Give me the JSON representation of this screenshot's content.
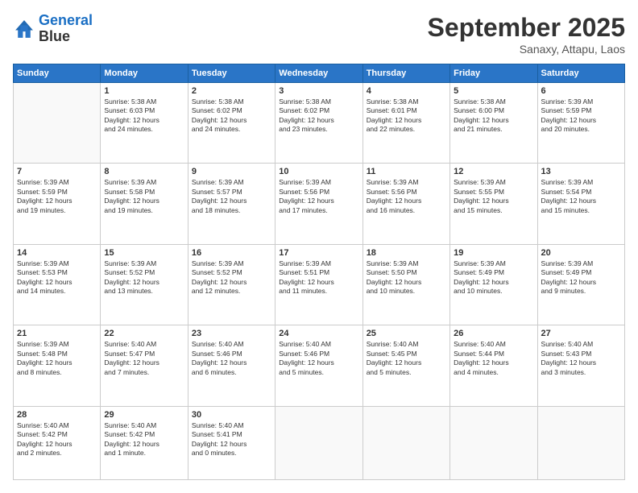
{
  "header": {
    "logo": {
      "line1": "General",
      "line2": "Blue"
    },
    "title": "September 2025",
    "subtitle": "Sanaxy, Attapu, Laos"
  },
  "weekdays": [
    "Sunday",
    "Monday",
    "Tuesday",
    "Wednesday",
    "Thursday",
    "Friday",
    "Saturday"
  ],
  "weeks": [
    [
      {
        "day": null,
        "lines": []
      },
      {
        "day": "1",
        "lines": [
          "Sunrise: 5:38 AM",
          "Sunset: 6:03 PM",
          "Daylight: 12 hours",
          "and 24 minutes."
        ]
      },
      {
        "day": "2",
        "lines": [
          "Sunrise: 5:38 AM",
          "Sunset: 6:02 PM",
          "Daylight: 12 hours",
          "and 24 minutes."
        ]
      },
      {
        "day": "3",
        "lines": [
          "Sunrise: 5:38 AM",
          "Sunset: 6:02 PM",
          "Daylight: 12 hours",
          "and 23 minutes."
        ]
      },
      {
        "day": "4",
        "lines": [
          "Sunrise: 5:38 AM",
          "Sunset: 6:01 PM",
          "Daylight: 12 hours",
          "and 22 minutes."
        ]
      },
      {
        "day": "5",
        "lines": [
          "Sunrise: 5:38 AM",
          "Sunset: 6:00 PM",
          "Daylight: 12 hours",
          "and 21 minutes."
        ]
      },
      {
        "day": "6",
        "lines": [
          "Sunrise: 5:39 AM",
          "Sunset: 5:59 PM",
          "Daylight: 12 hours",
          "and 20 minutes."
        ]
      }
    ],
    [
      {
        "day": "7",
        "lines": [
          "Sunrise: 5:39 AM",
          "Sunset: 5:59 PM",
          "Daylight: 12 hours",
          "and 19 minutes."
        ]
      },
      {
        "day": "8",
        "lines": [
          "Sunrise: 5:39 AM",
          "Sunset: 5:58 PM",
          "Daylight: 12 hours",
          "and 19 minutes."
        ]
      },
      {
        "day": "9",
        "lines": [
          "Sunrise: 5:39 AM",
          "Sunset: 5:57 PM",
          "Daylight: 12 hours",
          "and 18 minutes."
        ]
      },
      {
        "day": "10",
        "lines": [
          "Sunrise: 5:39 AM",
          "Sunset: 5:56 PM",
          "Daylight: 12 hours",
          "and 17 minutes."
        ]
      },
      {
        "day": "11",
        "lines": [
          "Sunrise: 5:39 AM",
          "Sunset: 5:56 PM",
          "Daylight: 12 hours",
          "and 16 minutes."
        ]
      },
      {
        "day": "12",
        "lines": [
          "Sunrise: 5:39 AM",
          "Sunset: 5:55 PM",
          "Daylight: 12 hours",
          "and 15 minutes."
        ]
      },
      {
        "day": "13",
        "lines": [
          "Sunrise: 5:39 AM",
          "Sunset: 5:54 PM",
          "Daylight: 12 hours",
          "and 15 minutes."
        ]
      }
    ],
    [
      {
        "day": "14",
        "lines": [
          "Sunrise: 5:39 AM",
          "Sunset: 5:53 PM",
          "Daylight: 12 hours",
          "and 14 minutes."
        ]
      },
      {
        "day": "15",
        "lines": [
          "Sunrise: 5:39 AM",
          "Sunset: 5:52 PM",
          "Daylight: 12 hours",
          "and 13 minutes."
        ]
      },
      {
        "day": "16",
        "lines": [
          "Sunrise: 5:39 AM",
          "Sunset: 5:52 PM",
          "Daylight: 12 hours",
          "and 12 minutes."
        ]
      },
      {
        "day": "17",
        "lines": [
          "Sunrise: 5:39 AM",
          "Sunset: 5:51 PM",
          "Daylight: 12 hours",
          "and 11 minutes."
        ]
      },
      {
        "day": "18",
        "lines": [
          "Sunrise: 5:39 AM",
          "Sunset: 5:50 PM",
          "Daylight: 12 hours",
          "and 10 minutes."
        ]
      },
      {
        "day": "19",
        "lines": [
          "Sunrise: 5:39 AM",
          "Sunset: 5:49 PM",
          "Daylight: 12 hours",
          "and 10 minutes."
        ]
      },
      {
        "day": "20",
        "lines": [
          "Sunrise: 5:39 AM",
          "Sunset: 5:49 PM",
          "Daylight: 12 hours",
          "and 9 minutes."
        ]
      }
    ],
    [
      {
        "day": "21",
        "lines": [
          "Sunrise: 5:39 AM",
          "Sunset: 5:48 PM",
          "Daylight: 12 hours",
          "and 8 minutes."
        ]
      },
      {
        "day": "22",
        "lines": [
          "Sunrise: 5:40 AM",
          "Sunset: 5:47 PM",
          "Daylight: 12 hours",
          "and 7 minutes."
        ]
      },
      {
        "day": "23",
        "lines": [
          "Sunrise: 5:40 AM",
          "Sunset: 5:46 PM",
          "Daylight: 12 hours",
          "and 6 minutes."
        ]
      },
      {
        "day": "24",
        "lines": [
          "Sunrise: 5:40 AM",
          "Sunset: 5:46 PM",
          "Daylight: 12 hours",
          "and 5 minutes."
        ]
      },
      {
        "day": "25",
        "lines": [
          "Sunrise: 5:40 AM",
          "Sunset: 5:45 PM",
          "Daylight: 12 hours",
          "and 5 minutes."
        ]
      },
      {
        "day": "26",
        "lines": [
          "Sunrise: 5:40 AM",
          "Sunset: 5:44 PM",
          "Daylight: 12 hours",
          "and 4 minutes."
        ]
      },
      {
        "day": "27",
        "lines": [
          "Sunrise: 5:40 AM",
          "Sunset: 5:43 PM",
          "Daylight: 12 hours",
          "and 3 minutes."
        ]
      }
    ],
    [
      {
        "day": "28",
        "lines": [
          "Sunrise: 5:40 AM",
          "Sunset: 5:42 PM",
          "Daylight: 12 hours",
          "and 2 minutes."
        ]
      },
      {
        "day": "29",
        "lines": [
          "Sunrise: 5:40 AM",
          "Sunset: 5:42 PM",
          "Daylight: 12 hours",
          "and 1 minute."
        ]
      },
      {
        "day": "30",
        "lines": [
          "Sunrise: 5:40 AM",
          "Sunset: 5:41 PM",
          "Daylight: 12 hours",
          "and 0 minutes."
        ]
      },
      {
        "day": null,
        "lines": []
      },
      {
        "day": null,
        "lines": []
      },
      {
        "day": null,
        "lines": []
      },
      {
        "day": null,
        "lines": []
      }
    ]
  ]
}
